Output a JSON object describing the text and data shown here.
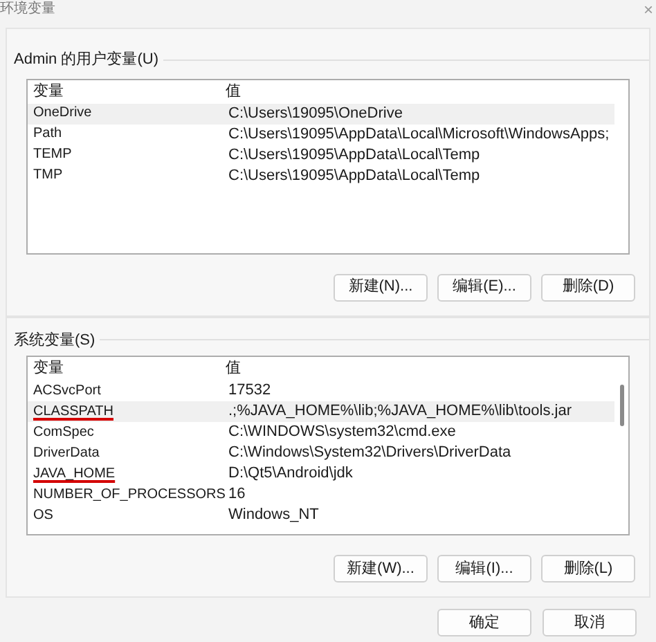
{
  "window": {
    "title": "环境变量",
    "close": "×"
  },
  "user_variables": {
    "label": "Admin 的用户变量(U)",
    "columns": [
      "变量",
      "值"
    ],
    "rows": [
      {
        "name": "OneDrive",
        "value": "C:\\Users\\19095\\OneDrive",
        "selected": true,
        "underlined": false
      },
      {
        "name": "Path",
        "value": "C:\\Users\\19095\\AppData\\Local\\Microsoft\\WindowsApps;",
        "selected": false,
        "underlined": false
      },
      {
        "name": "TEMP",
        "value": "C:\\Users\\19095\\AppData\\Local\\Temp",
        "selected": false,
        "underlined": false
      },
      {
        "name": "TMP",
        "value": "C:\\Users\\19095\\AppData\\Local\\Temp",
        "selected": false,
        "underlined": false
      }
    ],
    "buttons": [
      "新建(N)...",
      "编辑(E)...",
      "删除(D)"
    ]
  },
  "system_variables": {
    "label": "系统变量(S)",
    "columns": [
      "变量",
      "值"
    ],
    "rows": [
      {
        "name": "ACSvcPort",
        "value": "17532",
        "selected": false,
        "underlined": false
      },
      {
        "name": "CLASSPATH",
        "value": ".;%JAVA_HOME%\\lib;%JAVA_HOME%\\lib\\tools.jar",
        "selected": true,
        "underlined": true
      },
      {
        "name": "ComSpec",
        "value": "C:\\WINDOWS\\system32\\cmd.exe",
        "selected": false,
        "underlined": false
      },
      {
        "name": "DriverData",
        "value": "C:\\Windows\\System32\\Drivers\\DriverData",
        "selected": false,
        "underlined": false
      },
      {
        "name": "JAVA_HOME",
        "value": "D:\\Qt5\\Android\\jdk",
        "selected": false,
        "underlined": true
      },
      {
        "name": "NUMBER_OF_PROCESSORS",
        "value": "16",
        "selected": false,
        "underlined": false
      },
      {
        "name": "OS",
        "value": "Windows_NT",
        "selected": false,
        "underlined": false
      }
    ],
    "buttons": [
      "新建(W)...",
      "编辑(I)...",
      "删除(L)"
    ]
  },
  "dialog_buttons": [
    "确定",
    "取消"
  ]
}
